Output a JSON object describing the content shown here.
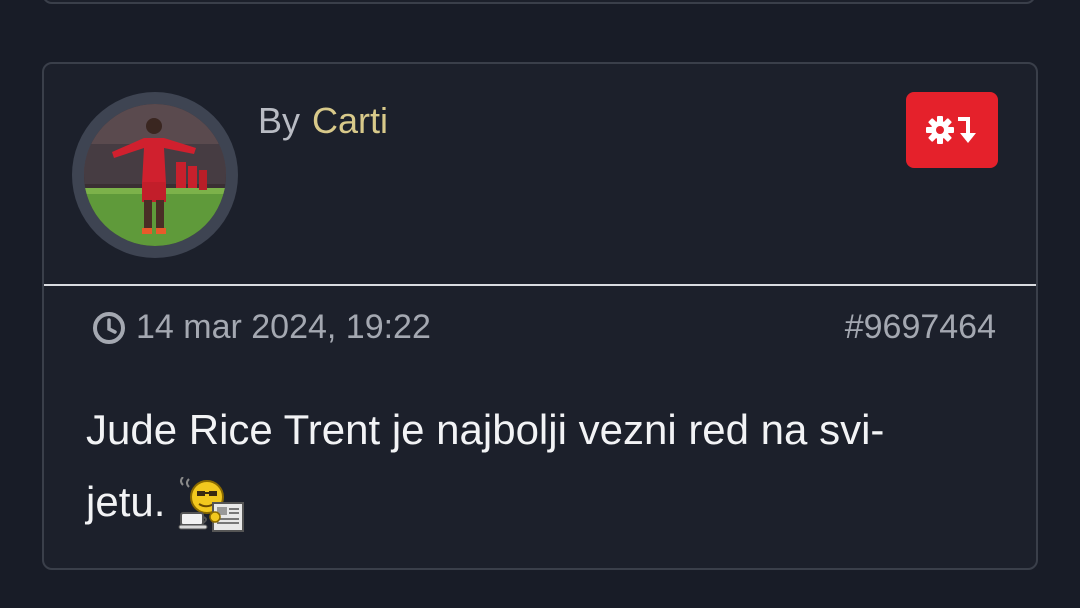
{
  "post": {
    "by_label": "By",
    "author": "Carti",
    "timestamp": "14 mar 2024, 19:22",
    "post_number": "#9697464",
    "body_line1": "Jude Rice Trent je najbolji vezni red na svi-",
    "body_line2": "jetu.",
    "emoticon": "coffee-newspaper-smiley-icon"
  },
  "icons": {
    "action_button": "gear-arrow-down-icon",
    "time": "clock-icon"
  },
  "colors": {
    "background": "#181c27",
    "card": "#1c202b",
    "author": "#d8c98a",
    "action_button": "#e5212b",
    "text": "#f2f3f5",
    "muted": "#a4a8b1"
  }
}
